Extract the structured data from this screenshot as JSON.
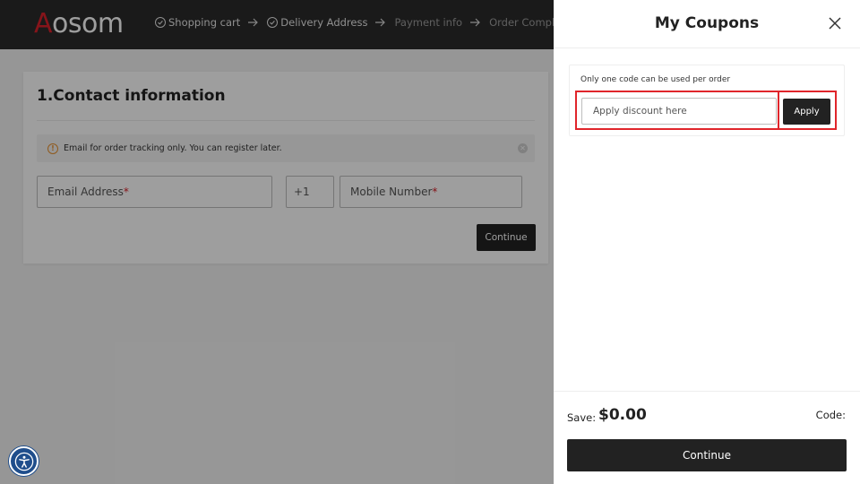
{
  "header": {
    "logo_first": "A",
    "logo_rest": "osom",
    "steps": [
      {
        "label": "Shopping cart",
        "done": true
      },
      {
        "label": "Delivery Address",
        "done": true
      },
      {
        "label": "Payment info",
        "done": false
      },
      {
        "label": "Order Complete",
        "done": false
      }
    ]
  },
  "contact": {
    "title": "1.Contact information",
    "notice": "Email for order tracking only. You can register later.",
    "email_placeholder": "Email Address",
    "country_code": "+1",
    "mobile_placeholder": "Mobile Number",
    "required_mark": "*",
    "continue_label": "Continue"
  },
  "coupons": {
    "title": "My Coupons",
    "note": "Only one code can be used per order",
    "input_placeholder": "Apply discount here",
    "apply_label": "Apply",
    "save_label": "Save:",
    "save_amount": "$0.00",
    "code_label": "Code:",
    "continue_label": "Continue"
  },
  "colors": {
    "brand_red": "#d8212a",
    "dark": "#222222",
    "highlight": "#e0252b",
    "accessibility_blue": "#1f4e8c"
  },
  "icons": {
    "close": "close-icon",
    "warning": "warning-icon",
    "accessibility": "accessibility-icon",
    "check": "check-circle-icon",
    "arrow": "arrow-right-icon"
  }
}
